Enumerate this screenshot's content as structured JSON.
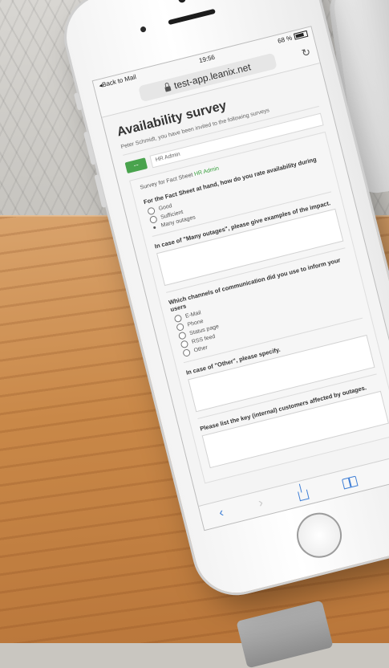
{
  "status": {
    "back": "◂Back to Mail",
    "time": "19:56",
    "battery": "68 %"
  },
  "browser": {
    "url": "test-app.leanix.net"
  },
  "page": {
    "title": "Availability survey",
    "intro": "Peter Schmidt, you have been invited to the following surveys",
    "role_badge": "--",
    "role_value": "HR Admin",
    "factsheet_prefix": "Survey for Fact Sheet",
    "factsheet_link": "HR Admin"
  },
  "questions": {
    "q1": "For the Fact Sheet at hand, how do you rate availability during",
    "q1_options": [
      "Good",
      "Sufficient",
      "Many outages"
    ],
    "q2": "In case of \"Many outages\", please give examples of the impact.",
    "q3": "Which channels of communication did you use to inform your users",
    "q3_options": [
      "E-Mail",
      "Phone",
      "Status page",
      "RSS feed",
      "Other"
    ],
    "q4": "In case of \"Other\", please specify.",
    "q5": "Please list the key (internal) customers affected by outages."
  },
  "toolbar": {
    "back": "‹",
    "forward": "›"
  },
  "colors": {
    "accent_green": "#49a34d",
    "ios_blue": "#3f7fd6"
  }
}
